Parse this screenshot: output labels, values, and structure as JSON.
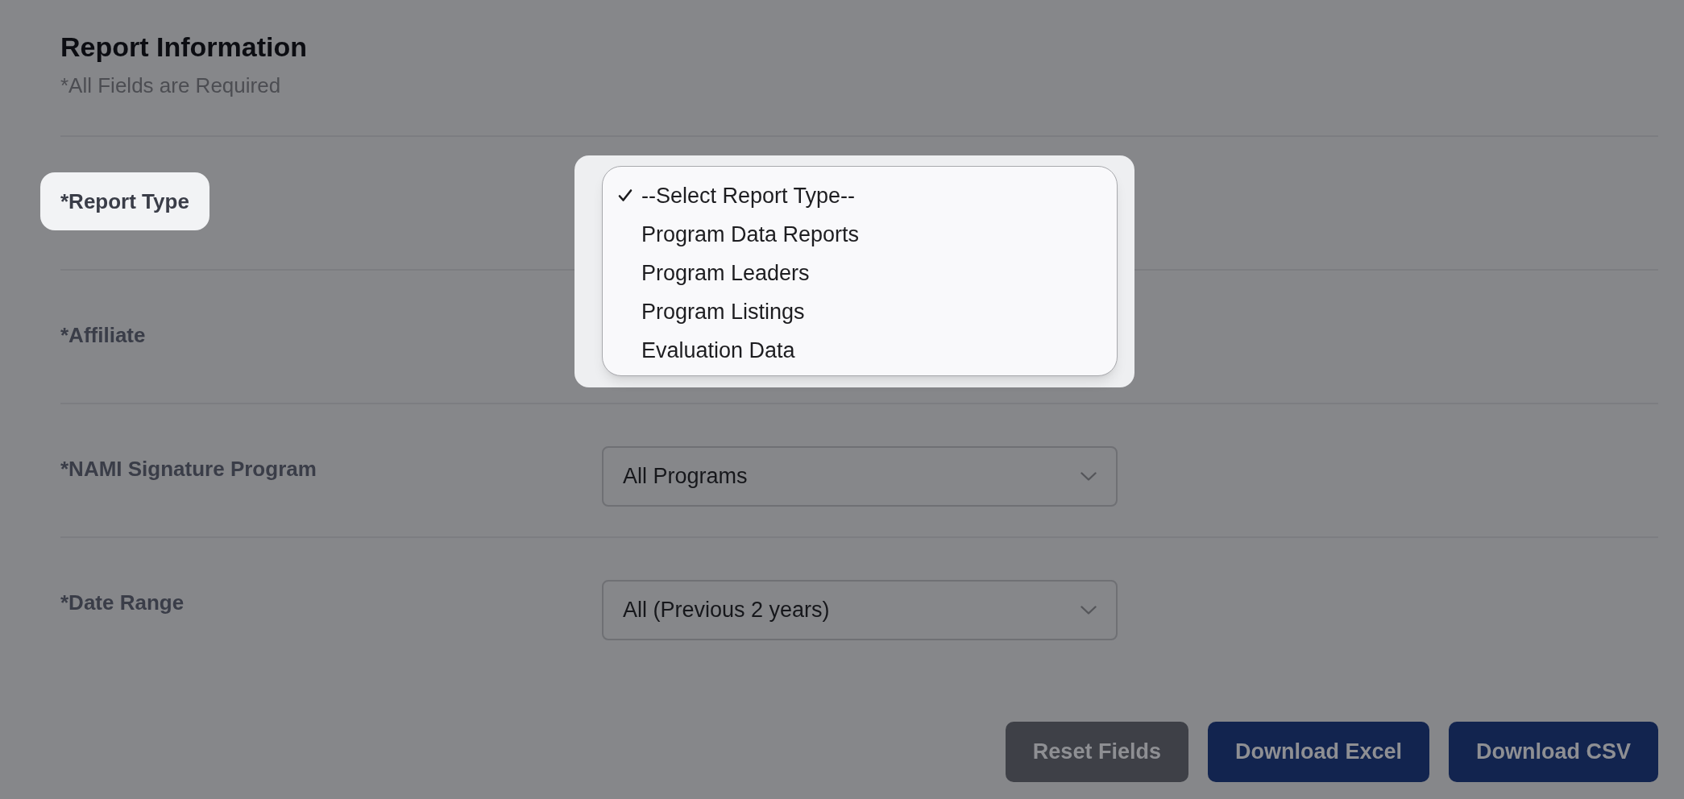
{
  "section": {
    "title": "Report Information",
    "subtitle": "*All Fields are Required"
  },
  "fields": [
    {
      "label": "*Report Type",
      "highlighted": true
    },
    {
      "label": "*Affiliate",
      "highlighted": false
    },
    {
      "label": "*NAMI Signature Program",
      "highlighted": false,
      "value": "All Programs"
    },
    {
      "label": "*Date Range",
      "highlighted": false,
      "value": "All (Previous 2 years)"
    }
  ],
  "dropdown_menu": {
    "options": [
      {
        "label": "--Select Report Type--",
        "selected": true
      },
      {
        "label": "Program Data Reports",
        "selected": false
      },
      {
        "label": "Program Leaders",
        "selected": false
      },
      {
        "label": "Program Listings",
        "selected": false
      },
      {
        "label": "Evaluation Data",
        "selected": false
      }
    ]
  },
  "buttons": [
    {
      "label": "Reset Fields",
      "kind": "secondary"
    },
    {
      "label": "Download Excel",
      "kind": "primary"
    },
    {
      "label": "Download CSV",
      "kind": "primary"
    }
  ]
}
